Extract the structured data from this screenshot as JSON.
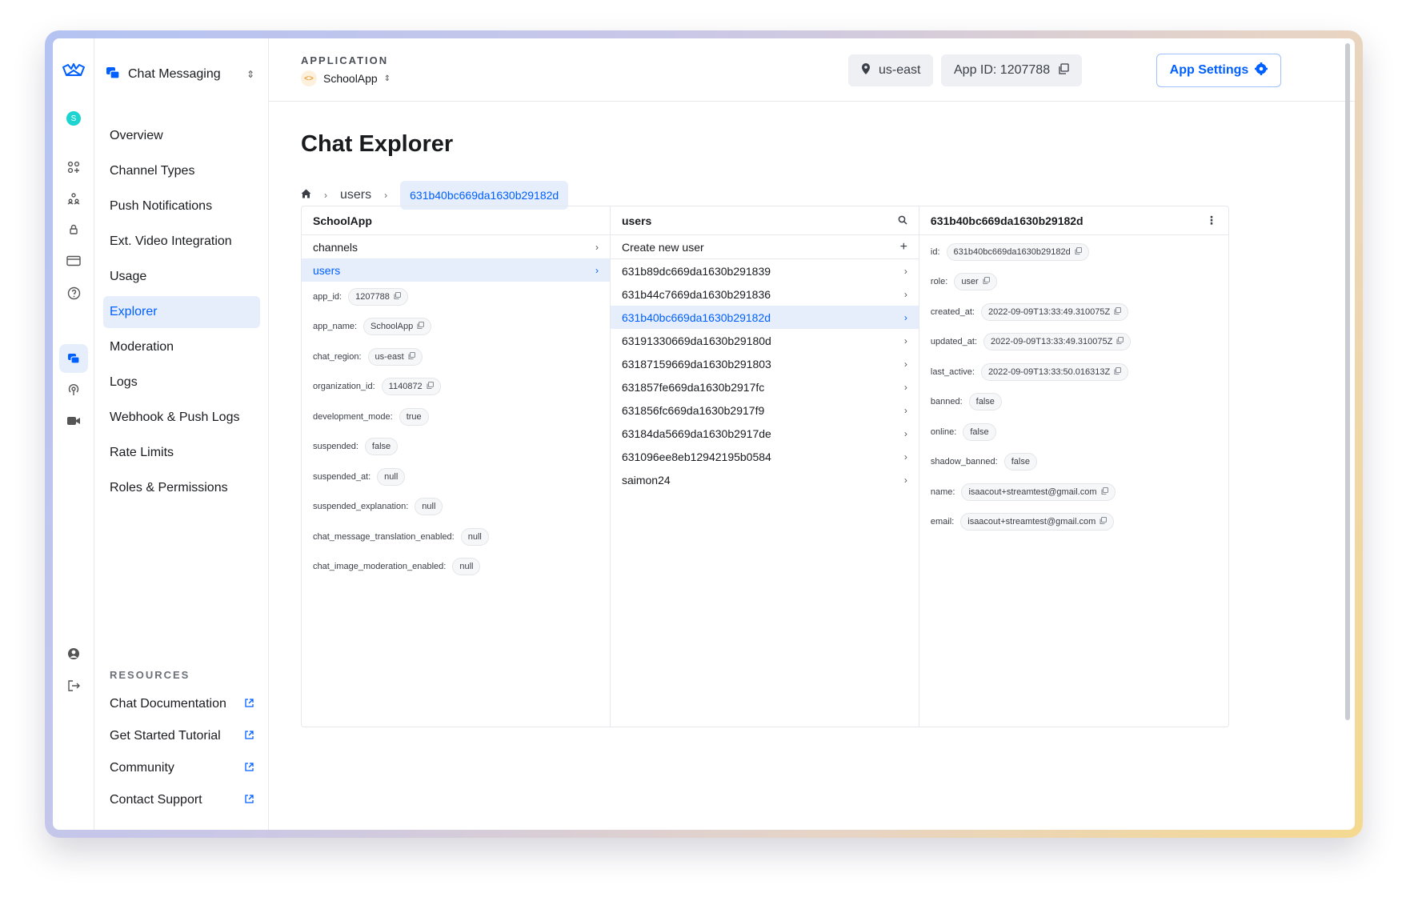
{
  "sidebar": {
    "app_name": "Chat Messaging",
    "nav": [
      {
        "label": "Overview"
      },
      {
        "label": "Channel Types"
      },
      {
        "label": "Push Notifications"
      },
      {
        "label": "Ext. Video Integration"
      },
      {
        "label": "Usage"
      },
      {
        "label": "Explorer",
        "active": true
      },
      {
        "label": "Moderation"
      },
      {
        "label": "Logs"
      },
      {
        "label": "Webhook & Push Logs"
      },
      {
        "label": "Rate Limits"
      },
      {
        "label": "Roles & Permissions"
      }
    ],
    "resources_heading": "RESOURCES",
    "resources": [
      {
        "label": "Chat Documentation"
      },
      {
        "label": "Get Started Tutorial"
      },
      {
        "label": "Community"
      },
      {
        "label": "Contact Support"
      }
    ]
  },
  "rail": {
    "avatar_letter": "S"
  },
  "header": {
    "application_label": "APPLICATION",
    "application_name": "SchoolApp",
    "region": "us-east",
    "app_id": "App ID: 1207788",
    "settings": "App Settings"
  },
  "page": {
    "title": "Chat Explorer",
    "breadcrumb": [
      "users",
      "631b40bc669da1630b29182d"
    ]
  },
  "col1": {
    "title": "SchoolApp",
    "items": [
      "channels",
      "users"
    ],
    "fields": [
      {
        "key": "app_id:",
        "value": "1207788",
        "copy": true
      },
      {
        "key": "app_name:",
        "value": "SchoolApp",
        "copy": true
      },
      {
        "key": "chat_region:",
        "value": "us-east",
        "copy": true
      },
      {
        "key": "organization_id:",
        "value": "1140872",
        "copy": true
      },
      {
        "key": "development_mode:",
        "value": "true",
        "copy": false
      },
      {
        "key": "suspended:",
        "value": "false",
        "copy": false
      },
      {
        "key": "suspended_at:",
        "value": "null",
        "copy": false
      },
      {
        "key": "suspended_explanation:",
        "value": "null",
        "copy": false
      },
      {
        "key": "chat_message_translation_enabled:",
        "value": "null",
        "copy": false
      },
      {
        "key": "chat_image_moderation_enabled:",
        "value": "null",
        "copy": false
      }
    ]
  },
  "col2": {
    "title": "users",
    "create": "Create new user",
    "users": [
      "631b89dc669da1630b291839",
      "631b44c7669da1630b291836",
      "631b40bc669da1630b29182d",
      "63191330669da1630b29180d",
      "63187159669da1630b291803",
      "631857fe669da1630b2917fc",
      "631856fc669da1630b2917f9",
      "63184da5669da1630b2917de",
      "631096ee8eb12942195b0584",
      "saimon24"
    ],
    "selected_index": 2
  },
  "col3": {
    "title": "631b40bc669da1630b29182d",
    "fields": [
      {
        "key": "id:",
        "value": "631b40bc669da1630b29182d",
        "copy": true
      },
      {
        "key": "role:",
        "value": "user",
        "copy": true
      },
      {
        "key": "created_at:",
        "value": "2022-09-09T13:33:49.310075Z",
        "copy": true
      },
      {
        "key": "updated_at:",
        "value": "2022-09-09T13:33:49.310075Z",
        "copy": true
      },
      {
        "key": "last_active:",
        "value": "2022-09-09T13:33:50.016313Z",
        "copy": true
      },
      {
        "key": "banned:",
        "value": "false",
        "copy": false
      },
      {
        "key": "online:",
        "value": "false",
        "copy": false
      },
      {
        "key": "shadow_banned:",
        "value": "false",
        "copy": false
      },
      {
        "key": "name:",
        "value": "isaacout+streamtest@gmail.com",
        "copy": true
      },
      {
        "key": "email:",
        "value": "isaacout+streamtest@gmail.com",
        "copy": true
      }
    ]
  },
  "colors": {
    "accent": "#005fff",
    "accent_bg": "#e6eefc",
    "border": "#e6e8ec"
  }
}
